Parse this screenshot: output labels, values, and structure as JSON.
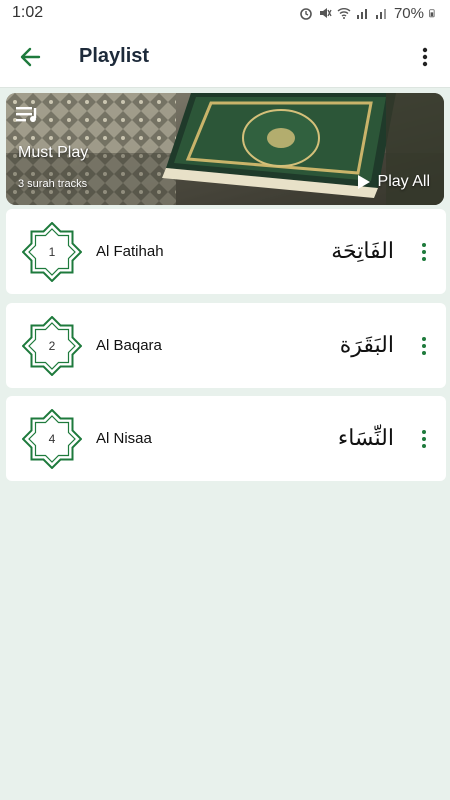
{
  "status_bar": {
    "time": "1:02",
    "battery": "70%"
  },
  "app_bar": {
    "title": "Playlist"
  },
  "banner": {
    "title": "Must Play",
    "subtitle": "3 surah tracks",
    "play_all": "Play All"
  },
  "tracks": [
    {
      "number": "1",
      "name": "Al Fatihah",
      "arabic": "الفَاتِحَة"
    },
    {
      "number": "2",
      "name": "Al Baqara",
      "arabic": "البَقَرَة"
    },
    {
      "number": "4",
      "name": "Al Nisaa",
      "arabic": "النِّسَاء"
    }
  ],
  "colors": {
    "accent": "#1e7a3c",
    "background": "#e8f1ec"
  }
}
